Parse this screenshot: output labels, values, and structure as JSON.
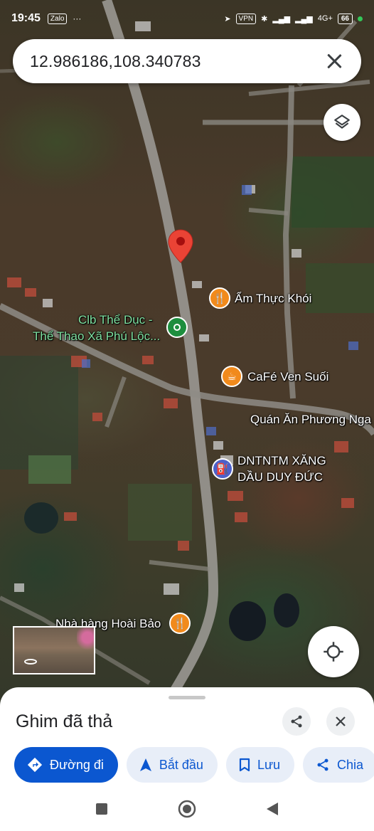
{
  "status_bar": {
    "time": "19:45",
    "app_icon": "Zalo",
    "more": "···",
    "vpn": "VPN",
    "network": "4G+",
    "battery": "66"
  },
  "search": {
    "query": "12.986186,108.340783",
    "close_icon": "close-icon"
  },
  "map": {
    "labels": {
      "am_thuc": "Ẩm Thực Khói",
      "clb_line1": "Clb Thể Dục -",
      "clb_line2": "Thể Thao Xã Phú Lộc...",
      "cafe": "CaFé Ven Suối",
      "quan_an": "Quán Ăn Phương Nga",
      "dntn_line1": "DNTNTM XĂNG",
      "dntn_line2": "DẦU DUY ĐỨC",
      "nha_hang": "Nhà hàng Hoài Bảo"
    },
    "pin_color": "#ea4335"
  },
  "sheet": {
    "title": "Ghim đã thả",
    "actions": {
      "directions": "Đường đi",
      "start": "Bắt đầu",
      "save": "Lưu",
      "share": "Chia"
    }
  },
  "colors": {
    "primary": "#0b57d0",
    "secondary_bg": "#e8eef8",
    "food_poi": "#f18a1c",
    "park_poi": "#1e8e3e",
    "fuel_poi": "#4d61c9"
  }
}
